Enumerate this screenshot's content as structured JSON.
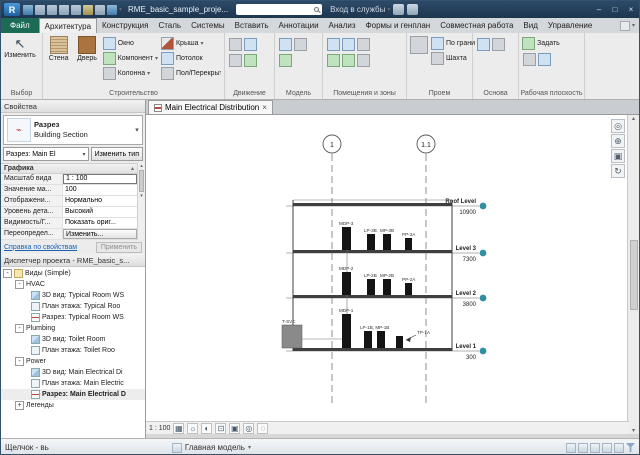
{
  "icons": {
    "chevron_down": "▾",
    "close": "×",
    "minimize": "–",
    "maximize": "□",
    "scroll_up": "▴",
    "scroll_down": "▾",
    "expand_minus": "-",
    "expand_plus": "+",
    "modify_cursor": "↖",
    "nav_wheel": "◎",
    "nav_zoom": "⊕",
    "nav_box": "▣",
    "nav_orbit": "↻",
    "help": "?"
  },
  "window": {
    "title": "RME_basic_sample_proje...",
    "sign_in": "Вход в службы",
    "status_left": "Щелчок - вь",
    "status_model": "Главная модель"
  },
  "ribbon": {
    "file_tab": "Файл",
    "tabs": [
      "Архитектура",
      "Конструкция",
      "Сталь",
      "Системы",
      "Вставить",
      "Аннотации",
      "Анализ",
      "Формы и генплан",
      "Совместная работа",
      "Вид",
      "Управление"
    ],
    "modify": "Изменить",
    "panels": {
      "select": {
        "label": "Выбор"
      },
      "build": {
        "label": "Строительство",
        "buttons": [
          "Стена",
          "Дверь",
          "Окно",
          "Компонент",
          "Колонна",
          "Крыша",
          "Потолок",
          "Пол/Перекрытие"
        ]
      },
      "circulation": {
        "label": "Движение"
      },
      "model": {
        "label": "Модель"
      },
      "rooms": {
        "label": "Помещения и зоны"
      },
      "opening": {
        "label": "Проем",
        "buttons": [
          "По грани",
          "Шахта"
        ]
      },
      "datum": {
        "label": "Основа"
      },
      "workplane": {
        "label": "Рабочая плоскость",
        "buttons": [
          "Задать"
        ]
      }
    }
  },
  "properties": {
    "header": "Свойства",
    "type_name": "Разрез",
    "type_family": "Building Section",
    "selector": "Разрез: Main El",
    "edit_type": "Изменить тип",
    "group": "Графика",
    "rows": [
      {
        "label": "Масштаб вида",
        "value": "1 : 100"
      },
      {
        "label": "Значение ма...",
        "value": "100"
      },
      {
        "label": "Отображени...",
        "value": "Нормально"
      },
      {
        "label": "Уровень дета...",
        "value": "Высокий"
      },
      {
        "label": "Видимость/Г...",
        "value": "Показать ориг..."
      },
      {
        "label": "Переопредел...",
        "value": "Изменить..."
      }
    ],
    "help_link": "Справка по свойствам",
    "apply": "Применить"
  },
  "browser": {
    "header": "Диспетчер проекта - RME_basic_s...",
    "root": "Виды (Simple)",
    "groups": [
      {
        "name": "HVAC",
        "items": [
          "3D вид: Typical Room WS",
          "План этажа: Typical Roo",
          "Разрез: Typical Room WS"
        ]
      },
      {
        "name": "Plumbing",
        "items": [
          "3D вид: Toilet Room",
          "План этажа: Toilet Roo"
        ]
      },
      {
        "name": "Power",
        "items": [
          "3D вид: Main Electrical Di",
          "План этажа: Main Electric",
          "Разрез: Main Electrical D"
        ]
      },
      {
        "name": "Легенды",
        "items": []
      }
    ]
  },
  "view": {
    "tab": "Main Electrical Distribution",
    "scale": "1 : 100",
    "controls": [
      {
        "name": "visual-style",
        "glyph": "▦"
      },
      {
        "name": "sun-path",
        "glyph": "☼"
      },
      {
        "name": "shadows",
        "glyph": "◐"
      },
      {
        "name": "crop-view",
        "glyph": "⊡"
      },
      {
        "name": "show-crop-region",
        "glyph": "▣"
      },
      {
        "name": "temporary-hide-isolate",
        "glyph": "◎"
      },
      {
        "name": "reveal-hidden",
        "glyph": "◌"
      }
    ]
  },
  "drawing": {
    "grids": [
      "1",
      "1.1"
    ],
    "levels": [
      {
        "name": "Roof Level",
        "elevation": "10900"
      },
      {
        "name": "Level 3",
        "elevation": "7300"
      },
      {
        "name": "Level 2",
        "elevation": "3800"
      },
      {
        "name": "Level 1",
        "elevation": "300"
      }
    ],
    "equipment": {
      "floor3": [
        "MDP-3",
        "LP-3B",
        "MP-3B",
        "PP-3A"
      ],
      "floor2": [
        "MDP-2",
        "LP-2B",
        "MP-2B",
        "PP-2A"
      ],
      "floor1": [
        "T-SVC",
        "MDP-1",
        "LP-1B, MP-1B",
        "TP-1A"
      ]
    }
  }
}
